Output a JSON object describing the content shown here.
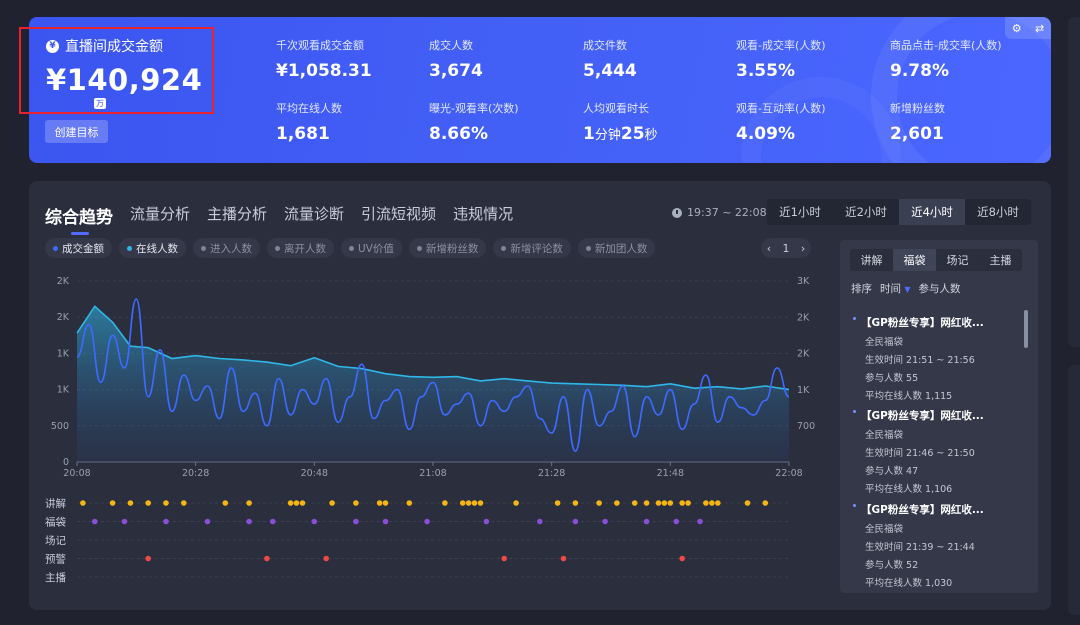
{
  "stats": {
    "main": {
      "label": "直播间成交金额",
      "value": "¥140,924",
      "unit_badge": "万",
      "goal_button": "创建目标"
    },
    "metrics": [
      {
        "label": "千次观看成交金额",
        "value": "¥1,058.31"
      },
      {
        "label": "成交人数",
        "value": "3,674"
      },
      {
        "label": "成交件数",
        "value": "5,444"
      },
      {
        "label": "观看-成交率(人数)",
        "value": "3.55%"
      },
      {
        "label": "商品点击-成交率(人数)",
        "value": "9.78%"
      },
      {
        "label": "平均在线人数",
        "value": "1,681"
      },
      {
        "label": "曝光-观看率(次数)",
        "value": "8.66%"
      },
      {
        "label": "人均观看时长",
        "value_min": "1",
        "unit_min": "分钟",
        "value_sec": "25",
        "unit_sec": "秒"
      },
      {
        "label": "观看-互动率(人数)",
        "value": "4.09%"
      },
      {
        "label": "新增粉丝数",
        "value": "2,601"
      }
    ]
  },
  "tabs": [
    "综合趋势",
    "流量分析",
    "主播分析",
    "流量诊断",
    "引流短视频",
    "违规情况"
  ],
  "time_range": "19:37 ~ 22:08",
  "range_options": [
    "近1小时",
    "近2小时",
    "近4小时",
    "近8小时"
  ],
  "range_selected": "近4小时",
  "chips": [
    {
      "label": "成交金额",
      "active": true,
      "color": "#3d6bff"
    },
    {
      "label": "在线人数",
      "active": true,
      "color": "#2fb7e8"
    },
    {
      "label": "进入人数",
      "active": false
    },
    {
      "label": "离开人数",
      "active": false
    },
    {
      "label": "UV价值",
      "active": false
    },
    {
      "label": "新增粉丝数",
      "active": false
    },
    {
      "label": "新增评论数",
      "active": false
    },
    {
      "label": "新加团人数",
      "active": false
    }
  ],
  "pager": {
    "prev": "‹",
    "page": "1",
    "next": "›"
  },
  "side": {
    "tabs": [
      "讲解",
      "福袋",
      "场记",
      "主播"
    ],
    "tab_selected": "福袋",
    "sort_label": "排序",
    "sort_time": "时间",
    "sort_people": "参与人数",
    "items": [
      {
        "title": "【GP粉丝专享】网红收...",
        "type": "全民福袋",
        "time": "生效时间 21:51 ~ 21:56",
        "people": "参与人数 55",
        "avg": "平均在线人数 1,115"
      },
      {
        "title": "【GP粉丝专享】网红收...",
        "type": "全民福袋",
        "time": "生效时间 21:46 ~ 21:50",
        "people": "参与人数 47",
        "avg": "平均在线人数 1,106"
      },
      {
        "title": "【GP粉丝专享】网红收...",
        "type": "全民福袋",
        "time": "生效时间 21:39 ~ 21:44",
        "people": "参与人数 52",
        "avg": "平均在线人数 1,030"
      }
    ]
  },
  "chart_data": {
    "type": "line",
    "x_ticks": [
      "20:08",
      "20:28",
      "20:48",
      "21:08",
      "21:28",
      "21:48",
      "22:08"
    ],
    "y_left_ticks": [
      "0",
      "500",
      "1K",
      "1K",
      "2K",
      "2K"
    ],
    "y_right_ticks": [
      "700",
      "1K",
      "2K",
      "2K",
      "3K"
    ],
    "series": [
      {
        "name": "在线人数",
        "color": "#2fb7e8",
        "x": [
          "20:08",
          "20:11",
          "20:14",
          "20:17",
          "20:20",
          "20:24",
          "20:28",
          "20:32",
          "20:36",
          "20:40",
          "20:44",
          "20:48",
          "20:52",
          "20:56",
          "21:00",
          "21:04",
          "21:08",
          "21:12",
          "21:16",
          "21:20",
          "21:24",
          "21:28",
          "21:32",
          "21:36",
          "21:40",
          "21:44",
          "21:48",
          "21:52",
          "21:56",
          "22:00",
          "22:04",
          "22:08"
        ],
        "values": [
          1780,
          2150,
          1930,
          1600,
          1580,
          1430,
          1470,
          1430,
          1410,
          1380,
          1330,
          1440,
          1320,
          1290,
          1220,
          1180,
          1170,
          1180,
          1120,
          1150,
          1120,
          1090,
          1080,
          1070,
          1060,
          1040,
          1080,
          1020,
          1040,
          1010,
          1050,
          1000
        ]
      },
      {
        "name": "成交金额",
        "color": "#3d6bff",
        "x": [
          "20:08",
          "20:10",
          "20:12",
          "20:14",
          "20:16",
          "20:18",
          "20:20",
          "20:22",
          "20:24",
          "20:26",
          "20:28",
          "20:30",
          "20:32",
          "20:34",
          "20:36",
          "20:38",
          "20:40",
          "20:42",
          "20:44",
          "20:46",
          "20:48",
          "20:50",
          "20:52",
          "20:54",
          "20:56",
          "20:58",
          "21:00",
          "21:02",
          "21:04",
          "21:06",
          "21:08",
          "21:10",
          "21:12",
          "21:14",
          "21:16",
          "21:18",
          "21:20",
          "21:22",
          "21:24",
          "21:26",
          "21:28",
          "21:30",
          "21:32",
          "21:34",
          "21:36",
          "21:38",
          "21:40",
          "21:42",
          "21:44",
          "21:46",
          "21:48",
          "21:50",
          "21:52",
          "21:54",
          "21:56",
          "21:58",
          "22:00",
          "22:02",
          "22:04",
          "22:06",
          "22:08"
        ],
        "values": [
          1450,
          1900,
          1100,
          1750,
          1300,
          2250,
          900,
          1550,
          700,
          1200,
          850,
          1050,
          600,
          1300,
          700,
          950,
          500,
          1150,
          650,
          1000,
          800,
          1150,
          550,
          900,
          1350,
          600,
          850,
          1000,
          450,
          900,
          1100,
          650,
          800,
          950,
          500,
          850,
          700,
          900,
          1050,
          600,
          400,
          900,
          150,
          1000,
          500,
          700,
          1050,
          350,
          900,
          650,
          1000,
          450,
          800,
          1200,
          550,
          900,
          750,
          650,
          850,
          1300,
          900
        ]
      }
    ],
    "events": {
      "rows": [
        "讲解",
        "福袋",
        "场记",
        "预警",
        "主播"
      ],
      "讲解": [
        "20:09",
        "20:14",
        "20:17",
        "20:20",
        "20:23",
        "20:26",
        "20:33",
        "20:37",
        "20:44",
        "20:45",
        "20:46",
        "20:51",
        "20:55",
        "20:59",
        "20:60",
        "21:04",
        "21:10",
        "21:13",
        "21:14",
        "21:15",
        "21:16",
        "21:22",
        "21:29",
        "21:32",
        "21:36",
        "21:39",
        "21:42",
        "21:44",
        "21:46",
        "21:47",
        "21:48",
        "21:50",
        "21:51",
        "21:54",
        "21:55",
        "21:56",
        "22:01",
        "22:04"
      ],
      "福袋": [
        "20:11",
        "20:16",
        "20:23",
        "20:30",
        "20:37",
        "20:41",
        "20:48",
        "20:55",
        "21:00",
        "21:07",
        "21:17",
        "21:26",
        "21:32",
        "21:37",
        "21:44",
        "21:49",
        "21:53"
      ],
      "场记": [],
      "预警": [
        "20:20",
        "20:40",
        "20:50",
        "21:20",
        "21:30",
        "21:50"
      ],
      "主播": []
    }
  }
}
